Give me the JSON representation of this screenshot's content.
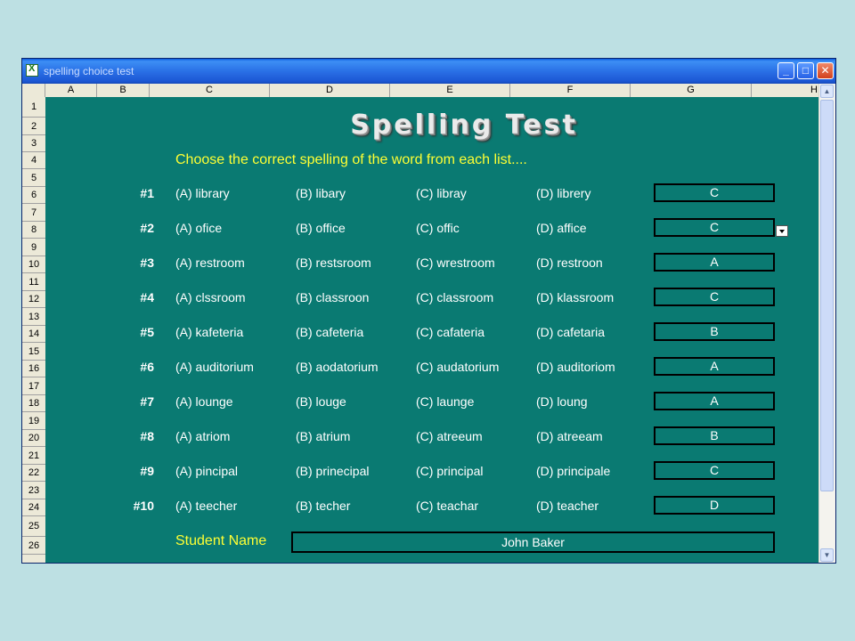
{
  "window": {
    "title": "spelling choice test"
  },
  "columns": [
    "A",
    "B",
    "C",
    "D",
    "E",
    "F",
    "G",
    "H"
  ],
  "rows": [
    "1",
    "2",
    "3",
    "4",
    "5",
    "6",
    "7",
    "8",
    "9",
    "10",
    "11",
    "12",
    "13",
    "14",
    "15",
    "16",
    "17",
    "18",
    "19",
    "20",
    "21",
    "22",
    "23",
    "24",
    "25",
    "26"
  ],
  "sheet": {
    "banner": "Spelling Test",
    "instruction": "Choose the correct spelling of the word from each list....",
    "questions": [
      {
        "num": "#1",
        "a": "(A) library",
        "b": "(B) libary",
        "c": "(C) libray",
        "d": "(D) librery",
        "answer": "C"
      },
      {
        "num": "#2",
        "a": "(A) ofice",
        "b": "(B) office",
        "c": "(C) offic",
        "d": "(D) affice",
        "answer": "C"
      },
      {
        "num": "#3",
        "a": "(A) restroom",
        "b": "(B) restsroom",
        "c": "(C) wrestroom",
        "d": "(D) restroon",
        "answer": "A"
      },
      {
        "num": "#4",
        "a": "(A) clssroom",
        "b": "(B) classroon",
        "c": "(C) classroom",
        "d": "(D) klassroom",
        "answer": "C"
      },
      {
        "num": "#5",
        "a": "(A) kafeteria",
        "b": "(B) cafeteria",
        "c": "(C) cafateria",
        "d": "(D) cafetaria",
        "answer": "B"
      },
      {
        "num": "#6",
        "a": "(A) auditorium",
        "b": "(B) aodatorium",
        "c": "(C) audatorium",
        "d": "(D) auditoriom",
        "answer": "A"
      },
      {
        "num": "#7",
        "a": "(A) lounge",
        "b": "(B) louge",
        "c": "(C) launge",
        "d": "(D) loung",
        "answer": "A"
      },
      {
        "num": "#8",
        "a": "(A) atriom",
        "b": "(B) atrium",
        "c": "(C) atreeum",
        "d": "(D) atreeam",
        "answer": "B"
      },
      {
        "num": "#9",
        "a": "(A) pincipal",
        "b": "(B) prinecipal",
        "c": "(C) principal",
        "d": "(D) principale",
        "answer": "C"
      },
      {
        "num": "#10",
        "a": "(A) teecher",
        "b": "(B) techer",
        "c": "(C) teachar",
        "d": "(D) teacher",
        "answer": "D"
      }
    ],
    "student_label": "Student Name",
    "student_name": "John Baker"
  },
  "colors": {
    "sheet_background": "#0a7a72",
    "instruction_text": "#ffff33",
    "page_background": "#bde0e3"
  },
  "icons": {
    "app": "excel-icon",
    "minimize": "minimize-icon",
    "maximize": "maximize-icon",
    "close": "close-icon",
    "dropdown": "chevron-down-icon"
  }
}
